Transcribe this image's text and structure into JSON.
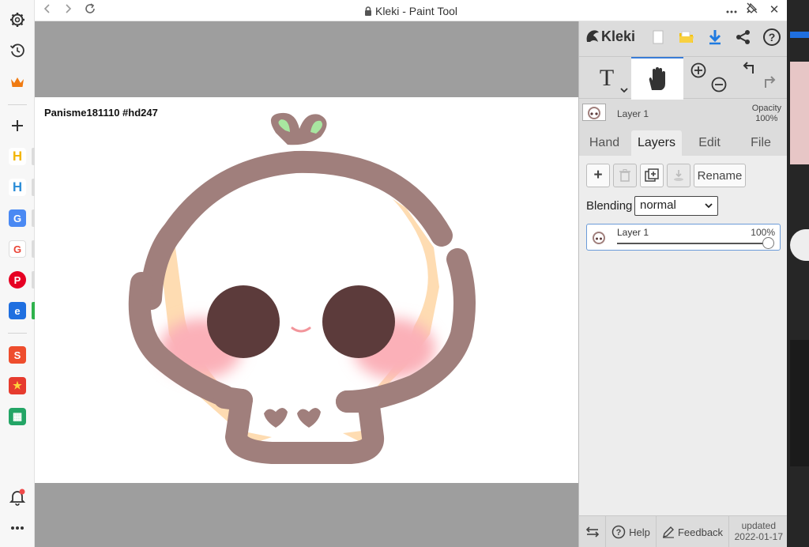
{
  "window": {
    "title": "Kleki - Paint Tool",
    "back_icon": "chevron-left-icon",
    "forward_icon": "chevron-right-icon",
    "reload_icon": "reload-icon",
    "lock_icon": "lock-icon",
    "more_icon": "more-horizontal-icon",
    "unpin_icon": "unpin-icon",
    "close_label": "✕"
  },
  "browser_sidebar": {
    "items": [
      {
        "name": "settings",
        "icon": "gear-icon"
      },
      {
        "name": "history",
        "icon": "history-icon"
      },
      {
        "name": "crown",
        "icon": "crown-icon",
        "color": "#f07b12"
      },
      {
        "name": "add",
        "icon": "plus-icon"
      },
      {
        "name": "app-h-1",
        "label": "H",
        "color": "#f3b600"
      },
      {
        "name": "app-h-2",
        "label": "H",
        "color": "#f3b600"
      },
      {
        "name": "google-translate",
        "label": "G",
        "color": "#4a89f3"
      },
      {
        "name": "google",
        "label": "G",
        "color": "#ea4335"
      },
      {
        "name": "pinterest",
        "label": "P",
        "color": "#e60023"
      },
      {
        "name": "app-blue",
        "label": "e",
        "color": "#1f6fe0"
      },
      {
        "name": "shopee",
        "label": "S",
        "color": "#ee4d2d"
      },
      {
        "name": "app-red-star",
        "label": "★",
        "color": "#e63b2e"
      },
      {
        "name": "sheets",
        "label": "▦",
        "color": "#23a566"
      }
    ],
    "bell_icon": "bell-icon",
    "more_icon": "more-horizontal-icon"
  },
  "canvas": {
    "caption": "Panisme181110 #hd247",
    "colors": {
      "outline": "#a07f7c",
      "skin": "#fedcb2",
      "eyes": "#5c3b3b",
      "blush": "#fbb0b8",
      "sprout": "#a8e6a0",
      "backdrop": "#9e9e9e"
    }
  },
  "panel": {
    "logo": "Kleki",
    "top_icons": [
      "new-file-icon",
      "open-folder-icon",
      "download-icon",
      "share-icon",
      "help-icon"
    ],
    "tools": [
      {
        "name": "text-tool",
        "label": "T",
        "active": false
      },
      {
        "name": "hand-tool",
        "icon": "hand-icon",
        "active": true
      },
      {
        "name": "zoom",
        "icons": [
          "zoom-in-icon",
          "zoom-out-icon"
        ]
      },
      {
        "name": "history",
        "icons": [
          "undo-icon",
          "redo-icon"
        ]
      }
    ],
    "current_layer": {
      "name": "Layer 1",
      "opacity_label": "Opacity",
      "opacity_value": "100%"
    },
    "tabs": [
      {
        "label": "Hand",
        "active": false
      },
      {
        "label": "Layers",
        "active": true
      },
      {
        "label": "Edit",
        "active": false
      },
      {
        "label": "File",
        "active": false
      }
    ],
    "layer_buttons": {
      "add": "+",
      "delete_icon": "trash-icon",
      "duplicate_icon": "duplicate-icon",
      "merge_icon": "merge-down-icon",
      "rename": "Rename"
    },
    "blending": {
      "label": "Blending",
      "value": "normal"
    },
    "layers": [
      {
        "name": "Layer 1",
        "opacity": "100%",
        "opacity_fraction": 1.0
      }
    ],
    "bottom": {
      "swap_icon": "swap-icon",
      "help": "Help",
      "feedback": "Feedback",
      "updated_label": "updated",
      "updated_date": "2022-01-17"
    }
  }
}
